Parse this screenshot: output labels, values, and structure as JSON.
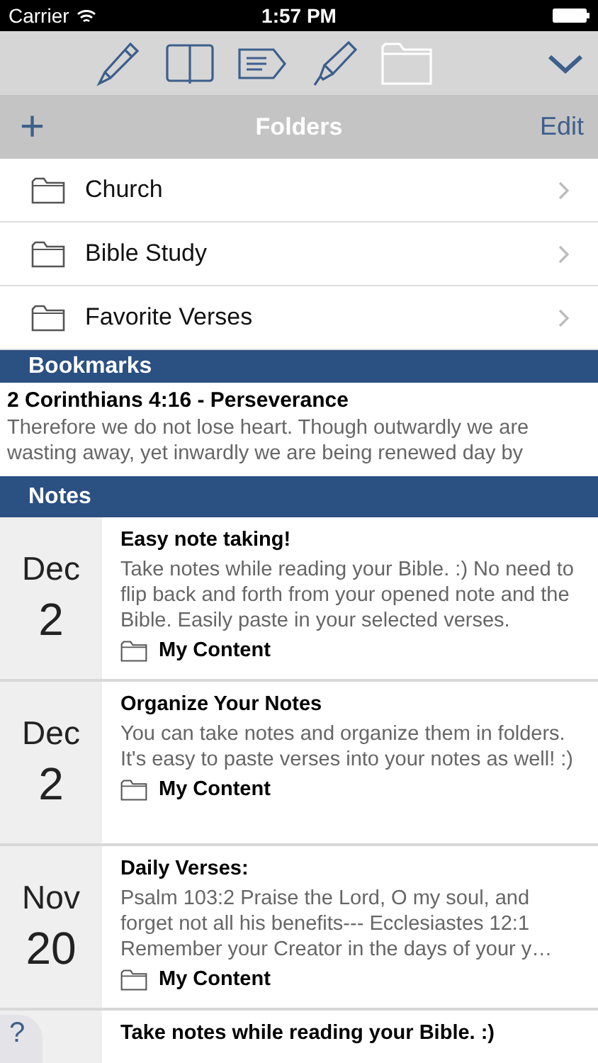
{
  "status_bar": {
    "carrier": "Carrier",
    "time": "1:57 PM"
  },
  "toolbar": {
    "tabs": [
      {
        "kind": "pencil",
        "selected": false
      },
      {
        "kind": "book",
        "selected": false
      },
      {
        "kind": "tag",
        "selected": false
      },
      {
        "kind": "highlighter",
        "selected": false
      },
      {
        "kind": "folder",
        "selected": true
      }
    ]
  },
  "nav_bar": {
    "add": "+",
    "title": "Folders",
    "edit": "Edit"
  },
  "folders": [
    {
      "name": "Church"
    },
    {
      "name": "Bible Study"
    },
    {
      "name": "Favorite Verses"
    }
  ],
  "bookmarks": {
    "header": "Bookmarks",
    "items": [
      {
        "title": "2 Corinthians 4:16 - Perseverance",
        "text": "Therefore we do not lose heart. Though outwardly we are wasting away, yet inwardly we are being renewed day by"
      }
    ]
  },
  "notes": {
    "header": "Notes",
    "items": [
      {
        "month": "Dec",
        "day": "2",
        "title": "Easy note taking!",
        "text": "Take notes while reading your Bible. :)   No need to flip back and forth from your opened note and the Bible. Easily paste in your selected verses.",
        "folder": "My Content"
      },
      {
        "month": "Dec",
        "day": "2",
        "title": "Organize Your Notes",
        "text": "You can take notes and organize them in folders. It's easy to paste verses into your notes as well! :)",
        "folder": "My Content"
      },
      {
        "month": "Nov",
        "day": "20",
        "title": "Daily Verses:",
        "text": "Psalm 103:2 Praise the Lord, O my soul, and forget not all his benefits---  Ecclesiastes 12:1 Remember your Creator in the days of your y…",
        "folder": "My Content"
      },
      {
        "title": "Take notes while reading your Bible. :)"
      }
    ]
  },
  "help_button": "?"
}
